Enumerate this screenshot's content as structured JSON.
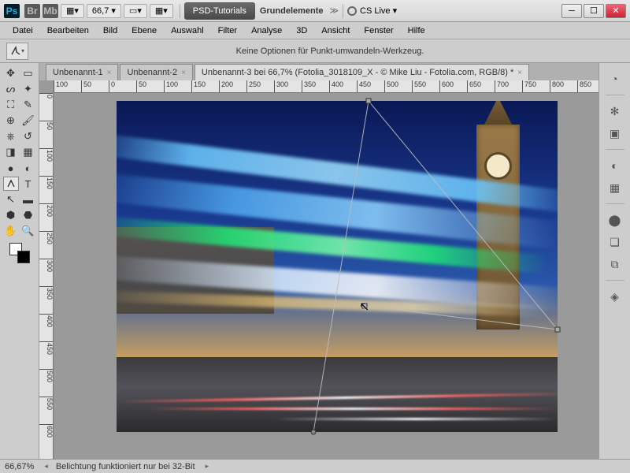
{
  "titlebar": {
    "zoom_value": "66,7",
    "psd_tutorials": "PSD-Tutorials",
    "grundelemente": "Grundelemente",
    "cslive": "CS Live"
  },
  "menu": {
    "datei": "Datei",
    "bearbeiten": "Bearbeiten",
    "bild": "Bild",
    "ebene": "Ebene",
    "auswahl": "Auswahl",
    "filter": "Filter",
    "analyse": "Analyse",
    "dd": "3D",
    "ansicht": "Ansicht",
    "fenster": "Fenster",
    "hilfe": "Hilfe"
  },
  "optionsbar": {
    "message": "Keine Optionen für Punkt-umwandeln-Werkzeug."
  },
  "tabs": [
    {
      "label": "Unbenannt-1",
      "active": false
    },
    {
      "label": "Unbenannt-2",
      "active": false
    },
    {
      "label": "Unbenannt-3 bei 66,7% (Fotolia_3018109_X - © Mike Liu - Fotolia.com, RGB/8) *",
      "active": true
    }
  ],
  "ruler_h": [
    "100",
    "50",
    "0",
    "50",
    "100",
    "150",
    "200",
    "250",
    "300",
    "350",
    "400",
    "450",
    "500",
    "550",
    "600",
    "650",
    "700",
    "750",
    "800",
    "850"
  ],
  "ruler_v": [
    "0",
    "50",
    "100",
    "150",
    "200",
    "250",
    "300",
    "350",
    "400",
    "450",
    "500",
    "550",
    "600"
  ],
  "status": {
    "zoom": "66,67%",
    "hint": "Belichtung funktioniert nur bei 32-Bit"
  },
  "colors": {
    "foreground": "#ffffff",
    "background": "#000000"
  }
}
